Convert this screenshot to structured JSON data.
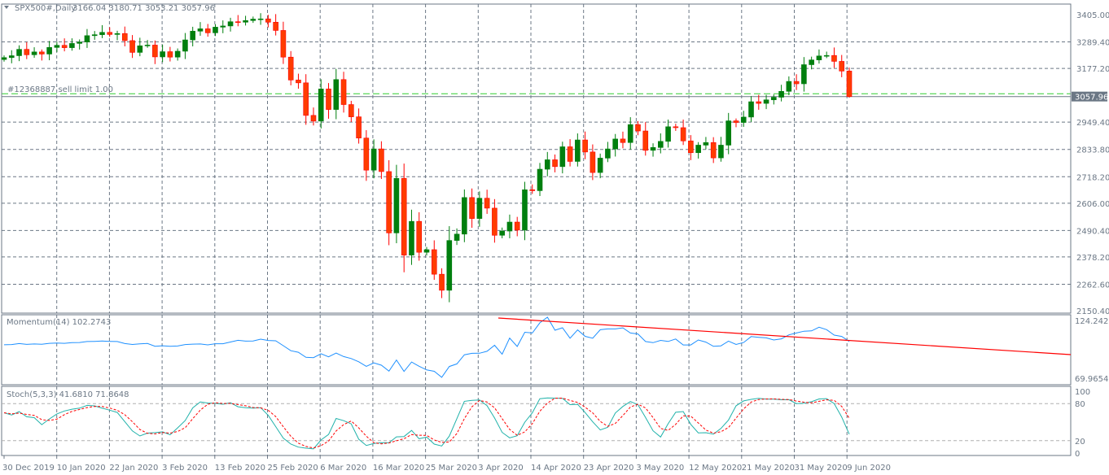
{
  "header": {
    "symbol": "SPX500#,Daily",
    "ohlc": "3166.04 3180.71 3053.21 3057.96"
  },
  "order_line": {
    "label": "#12368887 sell limit 1.00",
    "price": 3063,
    "color": "#32cd32"
  },
  "last_price": {
    "label": "3057.96",
    "value": 3057.96
  },
  "colors": {
    "bull": "#007f0e",
    "bear": "#ff3c00",
    "bear_border": "#ff0000",
    "grid": "#6b7785",
    "momentum": "#1e90ff",
    "stoch_main": "#20b2aa",
    "stoch_signal": "#ff0000",
    "trendline": "#ff0000"
  },
  "price_axis": {
    "max": 3405,
    "min": 2150.4,
    "labels": [
      "3405.00",
      "3289.40",
      "3177.20",
      "3057.96",
      "2949.40",
      "2833.80",
      "2718.20",
      "2606.00",
      "2490.40",
      "2378.20",
      "2262.60",
      "2150.40"
    ]
  },
  "momentum": {
    "label": "Momentum(14) 102.2743",
    "max": 124.2429,
    "min": 69.9654,
    "labels": [
      "124.2429",
      "69.9654"
    ]
  },
  "stoch": {
    "label": "Stoch(5,3,3) 41.6810 71.8648",
    "labels": [
      "100",
      "80",
      "20",
      "0"
    ]
  },
  "time_axis": [
    "30 Dec 2019",
    "10 Jan 2020",
    "22 Jan 2020",
    "3 Feb 2020",
    "13 Feb 2020",
    "25 Feb 2020",
    "6 Mar 2020",
    "16 Mar 2020",
    "25 Mar 2020",
    "3 Apr 2020",
    "14 Apr 2020",
    "23 Apr 2020",
    "3 May 2020",
    "12 May 2020",
    "21 May 2020",
    "31 May 2020",
    "9 Jun 2020"
  ],
  "chart_data": {
    "type": "candlestick",
    "closes": [
      3223,
      3231,
      3258,
      3235,
      3247,
      3238,
      3266,
      3275,
      3265,
      3283,
      3289,
      3316,
      3320,
      3330,
      3321,
      3325,
      3295,
      3245,
      3273,
      3276,
      3226,
      3248,
      3225,
      3250,
      3298,
      3335,
      3345,
      3328,
      3352,
      3357,
      3375,
      3373,
      3380,
      3386,
      3387,
      3373,
      3338,
      3225,
      3128,
      3116,
      2978,
      2954,
      3090,
      3003,
      3130,
      3024,
      2972,
      2882,
      2746,
      2836,
      2740,
      2480,
      2711,
      2386,
      2529,
      2398,
      2409,
      2305,
      2237,
      2448,
      2475,
      2630,
      2541,
      2627,
      2585,
      2470,
      2488,
      2526,
      2492,
      2663,
      2659,
      2750,
      2790,
      2761,
      2845,
      2783,
      2874,
      2823,
      2736,
      2797,
      2836,
      2878,
      2863,
      2939,
      2912,
      2830,
      2842,
      2868,
      2930,
      2926,
      2870,
      2820,
      2852,
      2863,
      2798,
      2852,
      2955,
      2948,
      2971,
      3036,
      3029,
      3044,
      3055,
      3080,
      3122,
      3112,
      3193,
      3213,
      3230,
      3232,
      3207,
      3166,
      3057.96
    ],
    "last_candle": {
      "o": 3166.04,
      "h": 3180.71,
      "l": 3053.21,
      "c": 3057.96
    }
  }
}
